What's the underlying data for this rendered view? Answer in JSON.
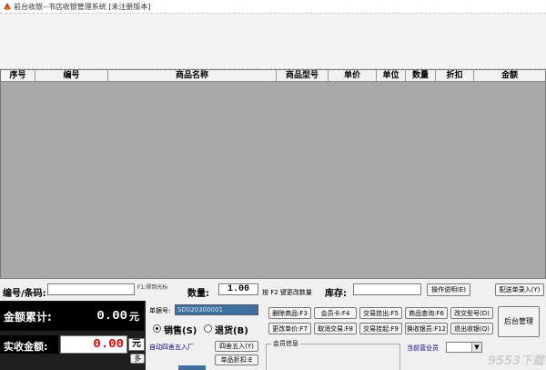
{
  "window": {
    "title": "前台收银--书店收银管理系统 [未注册版本]"
  },
  "grid": {
    "columns": [
      "序号",
      "编号",
      "商品名称",
      "商品型号",
      "单价",
      "单位",
      "数量",
      "折扣",
      "金额"
    ]
  },
  "entry": {
    "code_label": "编号/条码:",
    "f1_hint": "F1:得到光标",
    "qty_label": "数量:",
    "qty_value": "1.00",
    "f2_hint": "按 F2 键更改数量",
    "stock_label": "库存:",
    "help_button": "操作说明(E)",
    "price_order_button": "配送单录入(Y)"
  },
  "totals": {
    "sum_label": "金额累计:",
    "sum_value": "0.00",
    "sum_unit": "元",
    "received_label": "实收金额:",
    "received_value": "0.00",
    "received_unit": "元",
    "more_button": "多"
  },
  "order": {
    "number_label": "单据号:",
    "number_value": "SD020300001",
    "sale_label": "销售(S)",
    "return_label": "退货(B)",
    "auto_round_label": "自动四舍五入厂",
    "round_button": "四舍五入(Y)",
    "single_discount_button": "单品折扣:E"
  },
  "functions": {
    "row1": [
      "删除商品:F3",
      "会员卡:F4",
      "交易挂出:F5",
      "商品查询:F6",
      "改交型号(D)"
    ],
    "row2": [
      "更改单价:F7",
      "取消交易:F8",
      "交易挂起:F9",
      "换收银员:F12",
      "退出收银(Q)"
    ],
    "backend_button": "后台管理"
  },
  "member": {
    "group_label": "会员信息",
    "partial_label": "当前营业员"
  },
  "watermark": "9553下载"
}
